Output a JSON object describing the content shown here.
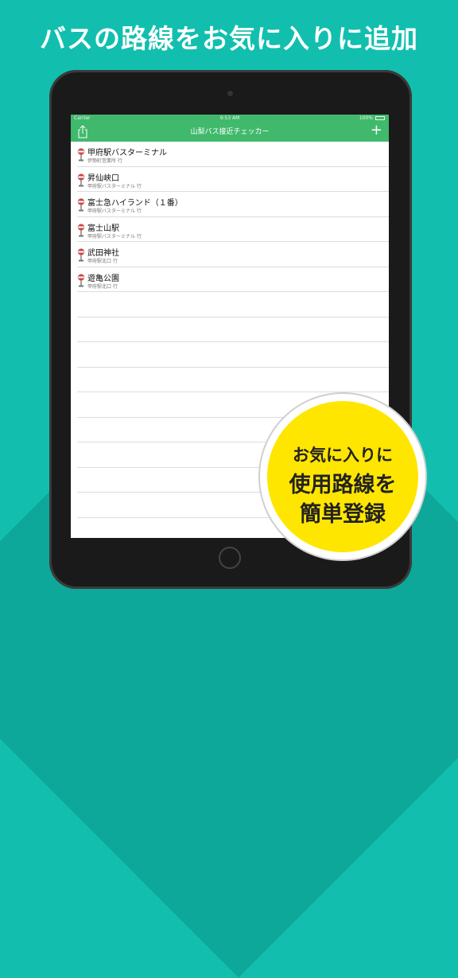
{
  "headline": "バスの路線をお気に入りに追加",
  "status_bar": {
    "carrier": "Carrier",
    "time": "9:53 AM",
    "battery": "100%"
  },
  "navbar": {
    "title": "山梨バス接近チェッカー",
    "share_icon": "share-icon",
    "add_icon": "plus-icon",
    "add_label": "+"
  },
  "favorites": [
    {
      "name": "甲府駅バスターミナル",
      "destination": "伊勢町営業所 行"
    },
    {
      "name": "昇仙峡口",
      "destination": "甲府駅バスターミナル 行"
    },
    {
      "name": "富士急ハイランド（１番）",
      "destination": "甲府駅バスターミナル 行"
    },
    {
      "name": "富士山駅",
      "destination": "甲府駅バスターミナル 行"
    },
    {
      "name": "武田神社",
      "destination": "甲府駅北口 行"
    },
    {
      "name": "遊亀公園",
      "destination": "甲府駅北口 行"
    }
  ],
  "badge": {
    "line1": "お気に入りに",
    "line2": "使用路線を",
    "line3": "簡単登録"
  },
  "colors": {
    "background": "#12bfae",
    "navbar": "#41b96c",
    "badge": "#ffe600",
    "bus_stop_red": "#e23b3b"
  }
}
